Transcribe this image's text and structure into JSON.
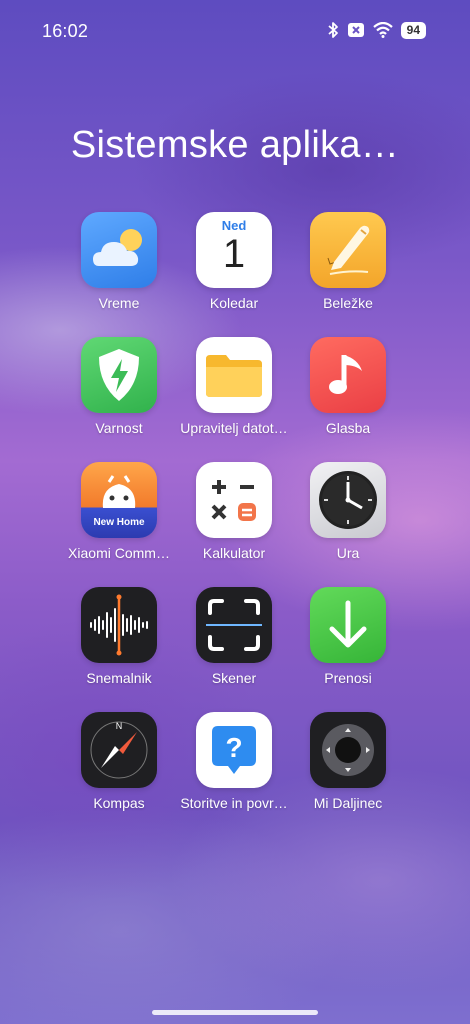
{
  "status_bar": {
    "time": "16:02",
    "battery": "94"
  },
  "folder": {
    "title": "Sistemske aplika…"
  },
  "apps": [
    {
      "label": "Vreme",
      "icon": "weather-icon"
    },
    {
      "label": "Koledar",
      "icon": "calendar-icon",
      "day_name": "Ned",
      "day_number": "1"
    },
    {
      "label": "Beležke",
      "icon": "notes-icon"
    },
    {
      "label": "Varnost",
      "icon": "security-shield-icon"
    },
    {
      "label": "Upravitelj datot…",
      "icon": "file-manager-folder-icon"
    },
    {
      "label": "Glasba",
      "icon": "music-note-icon"
    },
    {
      "label": "Xiaomi Comm…",
      "icon": "xiaomi-community-icon",
      "badge_text": "New Home"
    },
    {
      "label": "Kalkulator",
      "icon": "calculator-icon"
    },
    {
      "label": "Ura",
      "icon": "clock-icon"
    },
    {
      "label": "Snemalnik",
      "icon": "sound-recorder-icon"
    },
    {
      "label": "Skener",
      "icon": "scanner-icon"
    },
    {
      "label": "Prenosi",
      "icon": "downloads-icon"
    },
    {
      "label": "Kompas",
      "icon": "compass-icon"
    },
    {
      "label": "Storitve in povr…",
      "icon": "services-feedback-icon"
    },
    {
      "label": "Mi Daljinec",
      "icon": "mi-remote-icon"
    }
  ],
  "colors": {
    "weather": "#3f8ef0",
    "notes": "#f6b53a",
    "security": "#45c25a",
    "music": "#f0504e",
    "downloads": "#4cc845",
    "services": "#2e8cf0"
  }
}
